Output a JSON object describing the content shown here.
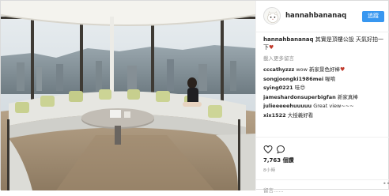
{
  "post": {
    "username": "hannahbananaq",
    "follow_label": "追蹤",
    "avatar_icon": "cat-avatar-icon",
    "caption_user": "hannahbananaq",
    "caption_text": " 其實是頂樓公設 天氣好拍一下",
    "load_more": "載入更多留言",
    "comments": [
      {
        "user": "cccathyzzz",
        "text": " wow 新家景色好棒",
        "emoji": "♥"
      },
      {
        "user": "songjoongki1986mei",
        "text": " 喔唷",
        "emoji": ""
      },
      {
        "user": "sying0221",
        "text": " 哇😍",
        "emoji": ""
      },
      {
        "user": "jameshardonsuperbigfan",
        "text": " 新家真棒",
        "emoji": ""
      },
      {
        "user": "julieeeeehuuuuu",
        "text": " Great view~~~",
        "emoji": ""
      },
      {
        "user": "xix1522",
        "text": " 大授義好看",
        "emoji": ""
      }
    ],
    "likes": "7,763 個讚",
    "date": "8小時",
    "add_comment_placeholder": "留言......",
    "more_label": "•••"
  },
  "colors": {
    "follow_button": "#3897f0",
    "muted_text": "#8e8e8e",
    "border": "#efefef"
  }
}
